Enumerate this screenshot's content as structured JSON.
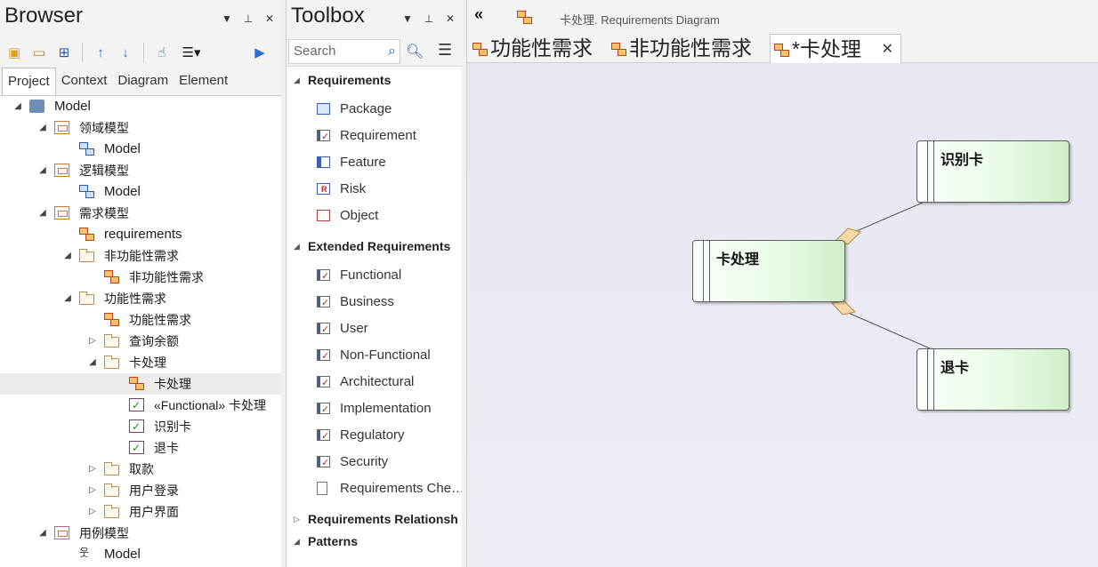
{
  "browser": {
    "title": "Browser",
    "tabs": [
      "Project",
      "Context",
      "Diagram",
      "Element"
    ],
    "active_tab": "Project",
    "tree": [
      {
        "label": "Model",
        "icon": "package-root-icon"
      },
      {
        "label": "领域模型",
        "icon": "view-icon"
      },
      {
        "label": "Model",
        "icon": "domain-diagram-icon"
      },
      {
        "label": "逻辑模型",
        "icon": "view-icon"
      },
      {
        "label": "Model",
        "icon": "logical-diagram-icon"
      },
      {
        "label": "需求模型",
        "icon": "view-icon"
      },
      {
        "label": "requirements",
        "icon": "requirements-diagram-icon"
      },
      {
        "label": "非功能性需求",
        "icon": "folder-icon"
      },
      {
        "label": "非功能性需求",
        "icon": "requirements-diagram-icon"
      },
      {
        "label": "功能性需求",
        "icon": "folder-icon"
      },
      {
        "label": "功能性需求",
        "icon": "requirements-diagram-icon"
      },
      {
        "label": "查询余额",
        "icon": "folder-icon"
      },
      {
        "label": "卡处理",
        "icon": "folder-icon"
      },
      {
        "label": "卡处理",
        "icon": "requirements-diagram-icon"
      },
      {
        "label": "«Functional» 卡处理",
        "icon": "requirement-icon"
      },
      {
        "label": "识别卡",
        "icon": "requirement-icon"
      },
      {
        "label": "退卡",
        "icon": "requirement-icon"
      },
      {
        "label": "取款",
        "icon": "folder-icon"
      },
      {
        "label": "用户登录",
        "icon": "folder-icon"
      },
      {
        "label": "用户界面",
        "icon": "folder-icon"
      },
      {
        "label": "用例模型",
        "icon": "view-icon"
      },
      {
        "label": "Model",
        "icon": "usecase-diagram-icon"
      }
    ]
  },
  "toolbox": {
    "title": "Toolbox",
    "search_placeholder": "Search",
    "groups": {
      "requirements": {
        "label": "Requirements",
        "items": [
          "Package",
          "Requirement",
          "Feature",
          "Risk",
          "Object"
        ]
      },
      "extended": {
        "label": "Extended Requirements",
        "items": [
          "Functional",
          "Business",
          "User",
          "Non-Functional",
          "Architectural",
          "Implementation",
          "Regulatory",
          "Security",
          "Requirements Che…"
        ]
      },
      "relationships": {
        "label": "Requirements Relationsh"
      },
      "patterns": {
        "label": "Patterns"
      }
    }
  },
  "diagram": {
    "path": "卡处理.  Requirements Diagram",
    "tabs": [
      "功能性需求",
      "非功能性需求",
      "*卡处理"
    ],
    "active_tab": "*卡处理",
    "nodes": {
      "card_processing": "卡处理",
      "identify_card": "识别卡",
      "return_card": "退卡"
    },
    "colors": {
      "node_fill": "#e4f8e0",
      "canvas": "#e8e9f2",
      "aggregation_diamond": "#f6d9a6"
    }
  }
}
